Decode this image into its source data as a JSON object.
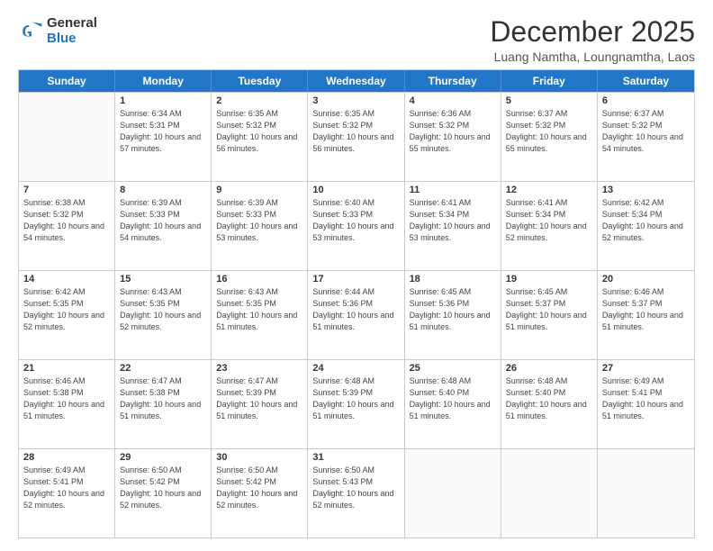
{
  "logo": {
    "general": "General",
    "blue": "Blue"
  },
  "header": {
    "month": "December 2025",
    "location": "Luang Namtha, Loungnamtha, Laos"
  },
  "weekdays": [
    "Sunday",
    "Monday",
    "Tuesday",
    "Wednesday",
    "Thursday",
    "Friday",
    "Saturday"
  ],
  "weeks": [
    [
      {
        "day": "",
        "empty": true
      },
      {
        "day": "1",
        "sunrise": "Sunrise: 6:34 AM",
        "sunset": "Sunset: 5:31 PM",
        "daylight": "Daylight: 10 hours and 57 minutes."
      },
      {
        "day": "2",
        "sunrise": "Sunrise: 6:35 AM",
        "sunset": "Sunset: 5:32 PM",
        "daylight": "Daylight: 10 hours and 56 minutes."
      },
      {
        "day": "3",
        "sunrise": "Sunrise: 6:35 AM",
        "sunset": "Sunset: 5:32 PM",
        "daylight": "Daylight: 10 hours and 56 minutes."
      },
      {
        "day": "4",
        "sunrise": "Sunrise: 6:36 AM",
        "sunset": "Sunset: 5:32 PM",
        "daylight": "Daylight: 10 hours and 55 minutes."
      },
      {
        "day": "5",
        "sunrise": "Sunrise: 6:37 AM",
        "sunset": "Sunset: 5:32 PM",
        "daylight": "Daylight: 10 hours and 55 minutes."
      },
      {
        "day": "6",
        "sunrise": "Sunrise: 6:37 AM",
        "sunset": "Sunset: 5:32 PM",
        "daylight": "Daylight: 10 hours and 54 minutes."
      }
    ],
    [
      {
        "day": "7",
        "sunrise": "Sunrise: 6:38 AM",
        "sunset": "Sunset: 5:32 PM",
        "daylight": "Daylight: 10 hours and 54 minutes."
      },
      {
        "day": "8",
        "sunrise": "Sunrise: 6:39 AM",
        "sunset": "Sunset: 5:33 PM",
        "daylight": "Daylight: 10 hours and 54 minutes."
      },
      {
        "day": "9",
        "sunrise": "Sunrise: 6:39 AM",
        "sunset": "Sunset: 5:33 PM",
        "daylight": "Daylight: 10 hours and 53 minutes."
      },
      {
        "day": "10",
        "sunrise": "Sunrise: 6:40 AM",
        "sunset": "Sunset: 5:33 PM",
        "daylight": "Daylight: 10 hours and 53 minutes."
      },
      {
        "day": "11",
        "sunrise": "Sunrise: 6:41 AM",
        "sunset": "Sunset: 5:34 PM",
        "daylight": "Daylight: 10 hours and 53 minutes."
      },
      {
        "day": "12",
        "sunrise": "Sunrise: 6:41 AM",
        "sunset": "Sunset: 5:34 PM",
        "daylight": "Daylight: 10 hours and 52 minutes."
      },
      {
        "day": "13",
        "sunrise": "Sunrise: 6:42 AM",
        "sunset": "Sunset: 5:34 PM",
        "daylight": "Daylight: 10 hours and 52 minutes."
      }
    ],
    [
      {
        "day": "14",
        "sunrise": "Sunrise: 6:42 AM",
        "sunset": "Sunset: 5:35 PM",
        "daylight": "Daylight: 10 hours and 52 minutes."
      },
      {
        "day": "15",
        "sunrise": "Sunrise: 6:43 AM",
        "sunset": "Sunset: 5:35 PM",
        "daylight": "Daylight: 10 hours and 52 minutes."
      },
      {
        "day": "16",
        "sunrise": "Sunrise: 6:43 AM",
        "sunset": "Sunset: 5:35 PM",
        "daylight": "Daylight: 10 hours and 51 minutes."
      },
      {
        "day": "17",
        "sunrise": "Sunrise: 6:44 AM",
        "sunset": "Sunset: 5:36 PM",
        "daylight": "Daylight: 10 hours and 51 minutes."
      },
      {
        "day": "18",
        "sunrise": "Sunrise: 6:45 AM",
        "sunset": "Sunset: 5:36 PM",
        "daylight": "Daylight: 10 hours and 51 minutes."
      },
      {
        "day": "19",
        "sunrise": "Sunrise: 6:45 AM",
        "sunset": "Sunset: 5:37 PM",
        "daylight": "Daylight: 10 hours and 51 minutes."
      },
      {
        "day": "20",
        "sunrise": "Sunrise: 6:46 AM",
        "sunset": "Sunset: 5:37 PM",
        "daylight": "Daylight: 10 hours and 51 minutes."
      }
    ],
    [
      {
        "day": "21",
        "sunrise": "Sunrise: 6:46 AM",
        "sunset": "Sunset: 5:38 PM",
        "daylight": "Daylight: 10 hours and 51 minutes."
      },
      {
        "day": "22",
        "sunrise": "Sunrise: 6:47 AM",
        "sunset": "Sunset: 5:38 PM",
        "daylight": "Daylight: 10 hours and 51 minutes."
      },
      {
        "day": "23",
        "sunrise": "Sunrise: 6:47 AM",
        "sunset": "Sunset: 5:39 PM",
        "daylight": "Daylight: 10 hours and 51 minutes."
      },
      {
        "day": "24",
        "sunrise": "Sunrise: 6:48 AM",
        "sunset": "Sunset: 5:39 PM",
        "daylight": "Daylight: 10 hours and 51 minutes."
      },
      {
        "day": "25",
        "sunrise": "Sunrise: 6:48 AM",
        "sunset": "Sunset: 5:40 PM",
        "daylight": "Daylight: 10 hours and 51 minutes."
      },
      {
        "day": "26",
        "sunrise": "Sunrise: 6:48 AM",
        "sunset": "Sunset: 5:40 PM",
        "daylight": "Daylight: 10 hours and 51 minutes."
      },
      {
        "day": "27",
        "sunrise": "Sunrise: 6:49 AM",
        "sunset": "Sunset: 5:41 PM",
        "daylight": "Daylight: 10 hours and 51 minutes."
      }
    ],
    [
      {
        "day": "28",
        "sunrise": "Sunrise: 6:49 AM",
        "sunset": "Sunset: 5:41 PM",
        "daylight": "Daylight: 10 hours and 52 minutes."
      },
      {
        "day": "29",
        "sunrise": "Sunrise: 6:50 AM",
        "sunset": "Sunset: 5:42 PM",
        "daylight": "Daylight: 10 hours and 52 minutes."
      },
      {
        "day": "30",
        "sunrise": "Sunrise: 6:50 AM",
        "sunset": "Sunset: 5:42 PM",
        "daylight": "Daylight: 10 hours and 52 minutes."
      },
      {
        "day": "31",
        "sunrise": "Sunrise: 6:50 AM",
        "sunset": "Sunset: 5:43 PM",
        "daylight": "Daylight: 10 hours and 52 minutes."
      },
      {
        "day": "",
        "empty": true
      },
      {
        "day": "",
        "empty": true
      },
      {
        "day": "",
        "empty": true
      }
    ]
  ]
}
